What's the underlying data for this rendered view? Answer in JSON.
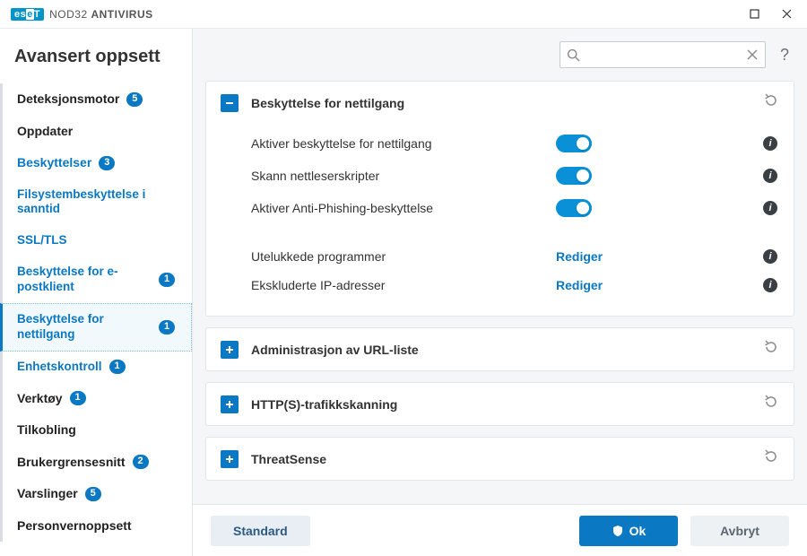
{
  "app": {
    "brand_prefix": "es",
    "brand_e": "e",
    "brand_suffix": "T",
    "product_thin": "NOD32 ",
    "product_bold": "ANTIVIRUS"
  },
  "page": {
    "title": "Avansert oppsett"
  },
  "search": {
    "placeholder": ""
  },
  "nav": {
    "deteksjon": {
      "label": "Deteksjonsmotor",
      "badge": "5"
    },
    "oppdater": {
      "label": "Oppdater"
    },
    "beskyttelser": {
      "label": "Beskyttelser",
      "badge": "3"
    },
    "fs_realtime": {
      "label": "Filsystembeskyttelse i sanntid"
    },
    "ssltls": {
      "label": "SSL/TLS"
    },
    "epost": {
      "label": "Beskyttelse for e-postklient",
      "badge": "1"
    },
    "web": {
      "label": "Beskyttelse for nettilgang",
      "badge": "1"
    },
    "enhet": {
      "label": "Enhetskontroll",
      "badge": "1"
    },
    "verktoy": {
      "label": "Verktøy",
      "badge": "1"
    },
    "tilkobling": {
      "label": "Tilkobling"
    },
    "ui": {
      "label": "Brukergrensesnitt",
      "badge": "2"
    },
    "varslinger": {
      "label": "Varslinger",
      "badge": "5"
    },
    "personvern": {
      "label": "Personvernoppsett"
    }
  },
  "panel_web": {
    "title": "Beskyttelse for nettilgang",
    "rows": {
      "enable_web": "Aktiver beskyttelse for nettilgang",
      "scan_scripts": "Skann nettleserskripter",
      "anti_phish": "Aktiver Anti-Phishing-beskyttelse",
      "excluded_apps": "Utelukkede programmer",
      "excluded_ips": "Ekskluderte IP-adresser"
    },
    "edit_label": "Rediger"
  },
  "panel_url": {
    "title": "Administrasjon av URL-liste"
  },
  "panel_http": {
    "title": "HTTP(S)-trafikkskanning"
  },
  "panel_ts": {
    "title": "ThreatSense"
  },
  "footer": {
    "default": "Standard",
    "ok": "Ok",
    "cancel": "Avbryt"
  }
}
